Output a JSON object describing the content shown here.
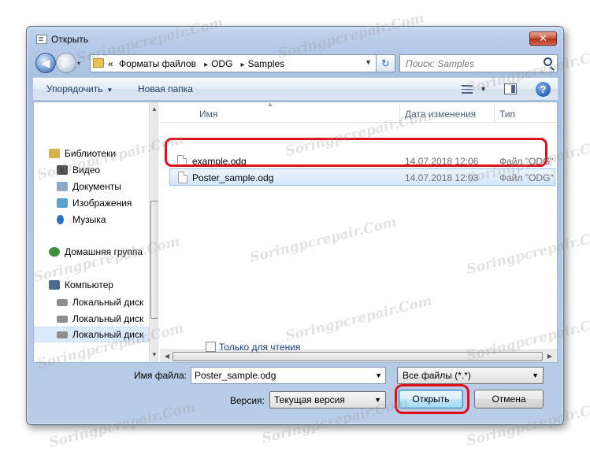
{
  "window": {
    "title": "Открыть",
    "close_glyph": "✕"
  },
  "nav": {
    "back_glyph": "◀",
    "forward_glyph": "▶",
    "history_glyph": "▾",
    "address_lead": "«",
    "path": [
      "Форматы файлов",
      "ODG",
      "Samples"
    ],
    "path_sep": "▸",
    "refresh_glyph": "↻",
    "search_placeholder": "Поиск: Samples"
  },
  "toolbar": {
    "organize_label": "Упорядочить",
    "new_folder_label": "Новая папка",
    "help_glyph": "?"
  },
  "sidebar": {
    "items": [
      {
        "label": "Библиотеки",
        "icon": "libraries-icon",
        "color": "#d9b04d"
      },
      {
        "label": "Видео",
        "icon": "video-icon",
        "color": "#4a4a4a"
      },
      {
        "label": "Документы",
        "icon": "documents-icon",
        "color": "#8fa9c9"
      },
      {
        "label": "Изображения",
        "icon": "pictures-icon",
        "color": "#5aa0c8"
      },
      {
        "label": "Музыка",
        "icon": "music-icon",
        "color": "#2f6fc4"
      },
      {
        "label": "Домашняя группа",
        "icon": "homegroup-icon",
        "color": "#3b8f3b"
      },
      {
        "label": "Компьютер",
        "icon": "computer-icon",
        "color": "#4a6a8f"
      },
      {
        "label": "Локальный диск",
        "icon": "drive-icon",
        "color": "#8f8f8f"
      },
      {
        "label": "Локальный диск",
        "icon": "drive-icon",
        "color": "#8f8f8f"
      },
      {
        "label": "Локальный диск",
        "icon": "drive-icon",
        "color": "#8f8f8f"
      }
    ]
  },
  "files": {
    "columns": {
      "name": "Имя",
      "date": "Дата изменения",
      "type": "Тип"
    },
    "rows": [
      {
        "name": "example.odg",
        "date": "14.07.2018 12:06",
        "type": "Файл \"ODG\""
      },
      {
        "name": "Poster_sample.odg",
        "date": "14.07.2018 12:03",
        "type": "Файл \"ODG\""
      }
    ]
  },
  "footer": {
    "readonly_label": "Только для чтения",
    "filename_label": "Имя файла:",
    "filename_value": "Poster_sample.odg",
    "filter_value": "Все файлы (*.*)",
    "version_label": "Версия:",
    "version_value": "Текущая версия",
    "open_label": "Открыть",
    "cancel_label": "Отмена"
  },
  "glyphs": {
    "dropdown": "▼",
    "up": "▲",
    "down": "▼",
    "left": "◀",
    "right": "▶"
  },
  "watermark": "Soringpcrepair.Com",
  "colors": {
    "highlight": "#e0101a",
    "selection": "#d3e6fb"
  }
}
